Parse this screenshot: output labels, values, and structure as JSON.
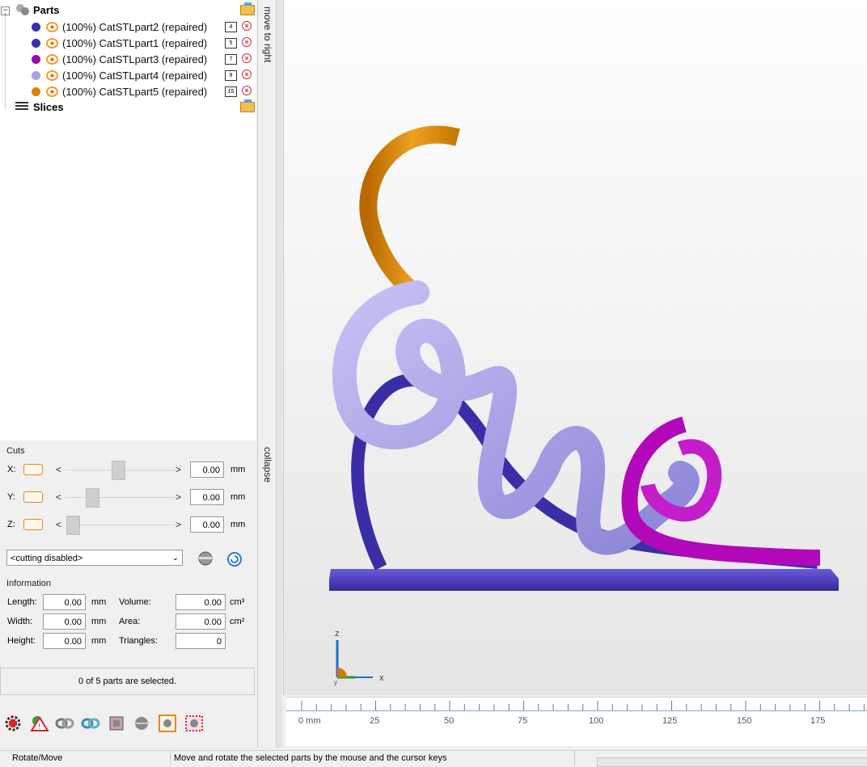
{
  "tree": {
    "parts_label": "Parts",
    "slices_label": "Slices",
    "parts": [
      {
        "label": "(100%) CatSTLpart2 (repaired)",
        "number": "4",
        "color": "#3b2fa8"
      },
      {
        "label": "(100%) CatSTLpart1 (repaired)",
        "number": "5",
        "color": "#3b2fa8"
      },
      {
        "label": "(100%) CatSTLpart3 (repaired)",
        "number": "7",
        "color": "#9b0aa8"
      },
      {
        "label": "(100%) CatSTLpart4 (repaired)",
        "number": "9",
        "color": "#a9a2e8"
      },
      {
        "label": "(100%) CatSTLpart5 (repaired)",
        "number": "15",
        "color": "#d98300"
      }
    ]
  },
  "tabs": {
    "move_to_right": "move to right",
    "collapse": "collapse"
  },
  "cuts": {
    "title": "Cuts",
    "axes": [
      {
        "axis": "X:",
        "value": "0.00",
        "unit": "mm"
      },
      {
        "axis": "Y:",
        "value": "0.00",
        "unit": "mm"
      },
      {
        "axis": "Z:",
        "value": "0.00",
        "unit": "mm"
      }
    ],
    "mode_select": "<cutting disabled>"
  },
  "information": {
    "title": "Information",
    "length": {
      "label": "Length:",
      "value": "0.00",
      "unit": "mm"
    },
    "width": {
      "label": "Width:",
      "value": "0.00",
      "unit": "mm"
    },
    "height": {
      "label": "Height:",
      "value": "0.00",
      "unit": "mm"
    },
    "volume": {
      "label": "Volume:",
      "value": "0.00",
      "unit": "cm³"
    },
    "area": {
      "label": "Area:",
      "value": "0.00",
      "unit": "cm²"
    },
    "triangles": {
      "label": "Triangles:",
      "value": "0"
    }
  },
  "selection_status": "0 of 5 parts are selected.",
  "toolbar_icons": [
    "settings-gear-icon",
    "warning-icon",
    "chain-link-icon",
    "sync-arrows-icon",
    "box-icon",
    "sphere-icon",
    "orange-square-icon",
    "red-grid-icon"
  ],
  "axes_gizmo": {
    "z": "z",
    "x": "x",
    "y": "y"
  },
  "ruler": {
    "labels": [
      "0 mm",
      "25",
      "50",
      "75",
      "100",
      "125",
      "150",
      "175"
    ]
  },
  "statusbar": {
    "mode": "Rotate/Move",
    "hint": "Move and rotate the selected parts by the mouse and the cursor keys"
  },
  "colors": {
    "base": "#4a3bb5",
    "part_orange": "#e08c00",
    "part_lavender": "#a9a4ec",
    "part_blue": "#3b2fa8",
    "part_magenta": "#b008b8"
  }
}
